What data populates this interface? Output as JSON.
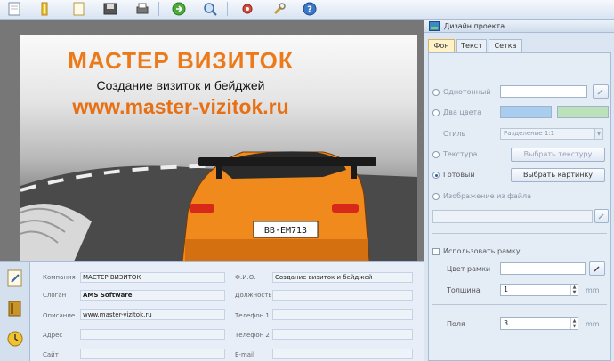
{
  "toolbar": {
    "icons": [
      "new-page-icon",
      "open-icon",
      "copy-icon",
      "save-icon",
      "print-icon",
      "export-icon",
      "zoom-icon",
      "settings-icon",
      "tools-icon",
      "help-icon"
    ]
  },
  "card": {
    "title": "МАСТЕР ВИЗИТОК",
    "subtitle": "Создание визиток и бейджей",
    "url": "www.master-vizitok.ru",
    "plate": "BB·EM713"
  },
  "form": {
    "fields": [
      {
        "label": "Компания",
        "value": "МАСТЕР ВИЗИТОК"
      },
      {
        "label": "Слоган",
        "value": "AMS Software"
      },
      {
        "label": "Описание",
        "value": "www.master-vizitok.ru"
      },
      {
        "label": "Адрес",
        "value": ""
      },
      {
        "label": "Сайт",
        "value": ""
      }
    ],
    "fields_right": [
      {
        "label": "Ф.И.О.",
        "value": "Создание визиток и бейджей"
      },
      {
        "label": "Должность",
        "value": ""
      },
      {
        "label": "Телефон 1",
        "value": ""
      },
      {
        "label": "Телефон 2",
        "value": ""
      },
      {
        "label": "E-mail",
        "value": ""
      }
    ]
  },
  "panel": {
    "title": "Дизайн проекта",
    "tabs": [
      "Фон",
      "Текст",
      "Сетка"
    ],
    "solid_label": "Однотонный",
    "two_colors_label": "Два цвета",
    "style_label": "Стиль",
    "style_value": "Разделение 1:1",
    "texture_label": "Текстура",
    "texture_button": "Выбрать текстуру",
    "ready_label": "Готовый",
    "ready_button": "Выбрать картинку",
    "from_file_label": "Изображение из файла",
    "use_frame_label": "Использовать рамку",
    "frame_color_label": "Цвет рамки",
    "thickness_label": "Толщина",
    "thickness_value": "1",
    "margins_label": "Поля",
    "margins_value": "3",
    "unit": "mm",
    "color_a": "#a9cdef",
    "color_b": "#bde1b8"
  },
  "colors": {
    "brand_orange": "#ec7a1a",
    "panel_bg": "#dce6f2"
  }
}
